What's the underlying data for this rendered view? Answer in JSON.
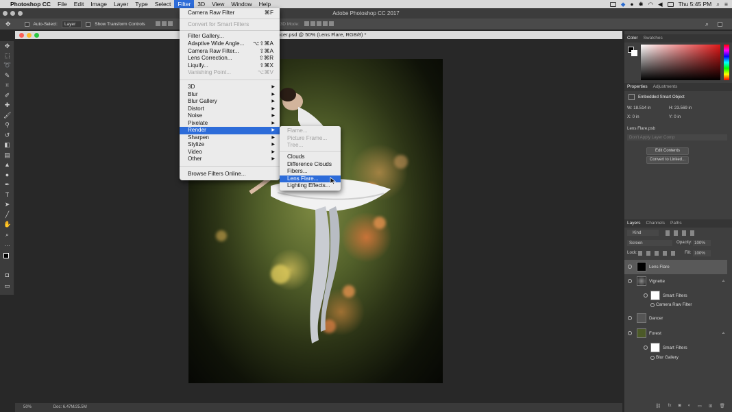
{
  "menubar": {
    "apple": "",
    "app_name": "Photoshop CC",
    "items": [
      "File",
      "Edit",
      "Image",
      "Layer",
      "Type",
      "Select",
      "Filter",
      "3D",
      "View",
      "Window",
      "Help"
    ],
    "active": "Filter",
    "clock": "Thu 5:45 PM"
  },
  "window": {
    "title": "Adobe Photoshop CC 2017"
  },
  "options_bar": {
    "auto_select_label": "Auto-Select:",
    "auto_select_value": "Layer",
    "transform_label": "Show Transform Controls",
    "mode_label": "3D Mode:"
  },
  "document": {
    "tab_title": "Dancer.psd @ 50% (Lens Flare, RGB/8) *",
    "zoom": "50%",
    "doc_size": "Doc: 6.47M/25.5M"
  },
  "filter_menu": {
    "items": [
      {
        "label": "Camera Raw Filter",
        "shortcut": "⌘F",
        "disabled": false
      },
      {
        "label": "Convert for Smart Filters",
        "shortcut": "",
        "disabled": true
      },
      {
        "label": "Filter Gallery...",
        "shortcut": "",
        "disabled": false
      },
      {
        "label": "Adaptive Wide Angle...",
        "shortcut": "⌥⇧⌘A",
        "disabled": false
      },
      {
        "label": "Camera Raw Filter...",
        "shortcut": "⇧⌘A",
        "disabled": false
      },
      {
        "label": "Lens Correction...",
        "shortcut": "⇧⌘R",
        "disabled": false
      },
      {
        "label": "Liquify...",
        "shortcut": "⇧⌘X",
        "disabled": false
      },
      {
        "label": "Vanishing Point...",
        "shortcut": "⌥⌘V",
        "disabled": true
      },
      {
        "label": "3D",
        "submenu": true
      },
      {
        "label": "Blur",
        "submenu": true
      },
      {
        "label": "Blur Gallery",
        "submenu": true
      },
      {
        "label": "Distort",
        "submenu": true
      },
      {
        "label": "Noise",
        "submenu": true
      },
      {
        "label": "Pixelate",
        "submenu": true
      },
      {
        "label": "Render",
        "submenu": true,
        "selected": true
      },
      {
        "label": "Sharpen",
        "submenu": true
      },
      {
        "label": "Stylize",
        "submenu": true
      },
      {
        "label": "Video",
        "submenu": true
      },
      {
        "label": "Other",
        "submenu": true
      },
      {
        "label": "Browse Filters Online..."
      }
    ]
  },
  "render_submenu": {
    "items": [
      {
        "label": "Flame...",
        "disabled": true
      },
      {
        "label": "Picture Frame...",
        "disabled": true
      },
      {
        "label": "Tree...",
        "disabled": true
      },
      {
        "label": "Clouds",
        "disabled": false
      },
      {
        "label": "Difference Clouds",
        "disabled": false
      },
      {
        "label": "Fibers...",
        "disabled": false
      },
      {
        "label": "Lens Flare...",
        "disabled": false,
        "selected": true
      },
      {
        "label": "Lighting Effects...",
        "disabled": false
      }
    ]
  },
  "color_panel": {
    "tabs": [
      "Color",
      "Swatches"
    ]
  },
  "properties_panel": {
    "tabs": [
      "Properties",
      "Adjustments"
    ],
    "title": "Embedded Smart Object",
    "w": "W: 18.514 in",
    "h": "H: 23.569 in",
    "x": "X: 0 in",
    "y": "Y: 0 in",
    "filename": "Lens Flare.psb",
    "layer_comp": "Don't Apply Layer Comp",
    "edit_button": "Edit Contents",
    "convert_button": "Convert to Linked..."
  },
  "layers_panel": {
    "tabs": [
      "Layers",
      "Channels",
      "Paths"
    ],
    "kind": "Kind",
    "blend_mode": "Screen",
    "opacity_label": "Opacity:",
    "opacity": "100%",
    "lock_label": "Lock:",
    "fill_label": "Fill:",
    "fill": "100%",
    "layers": [
      {
        "name": "Lens Flare",
        "active": true
      },
      {
        "name": "Vignette"
      },
      {
        "name": "Smart Filters"
      },
      {
        "name": "Camera Raw Filter"
      },
      {
        "name": "Dancer"
      },
      {
        "name": "Forest"
      },
      {
        "name": "Smart Filters"
      },
      {
        "name": "Blur Gallery"
      }
    ]
  },
  "colors": {
    "menu_highlight": "#2d6cd9",
    "panel_bg": "#3f3f3f",
    "canvas_bg": "#282828"
  }
}
